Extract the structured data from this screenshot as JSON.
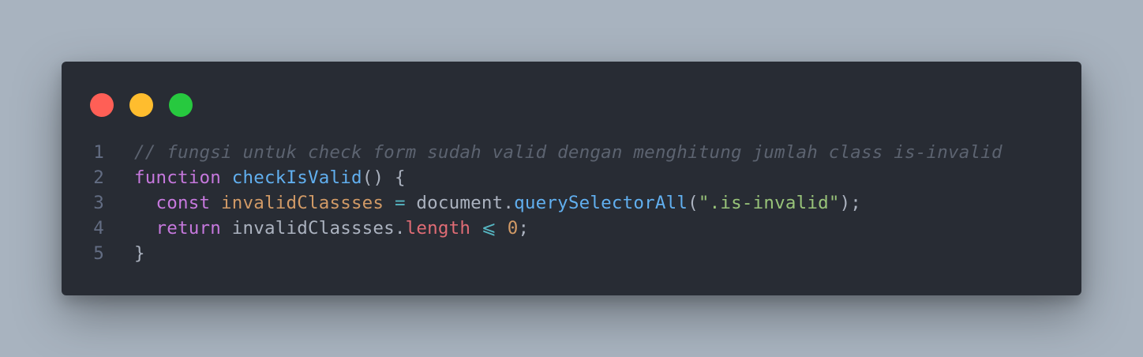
{
  "window": {
    "controls": [
      {
        "name": "close",
        "color": "#ff5f56"
      },
      {
        "name": "minimize",
        "color": "#ffbd2e"
      },
      {
        "name": "maximize",
        "color": "#27c93f"
      }
    ]
  },
  "code": {
    "lines": [
      {
        "number": "1",
        "tokens": [
          {
            "t": "// fungsi untuk check form sudah valid dengan menghitung jumlah class is-invalid",
            "k": "comment"
          }
        ]
      },
      {
        "number": "2",
        "tokens": [
          {
            "t": "function",
            "k": "kw"
          },
          {
            "t": " ",
            "k": "punc"
          },
          {
            "t": "checkIsValid",
            "k": "fn"
          },
          {
            "t": "() {",
            "k": "punc"
          }
        ]
      },
      {
        "number": "3",
        "tokens": [
          {
            "t": "  ",
            "k": "punc"
          },
          {
            "t": "const",
            "k": "kw"
          },
          {
            "t": " ",
            "k": "punc"
          },
          {
            "t": "invalidClassses",
            "k": "var"
          },
          {
            "t": " ",
            "k": "punc"
          },
          {
            "t": "=",
            "k": "op"
          },
          {
            "t": " document.",
            "k": "punc"
          },
          {
            "t": "querySelectorAll",
            "k": "fn"
          },
          {
            "t": "(",
            "k": "punc"
          },
          {
            "t": "\".is-invalid\"",
            "k": "str"
          },
          {
            "t": ");",
            "k": "punc"
          }
        ]
      },
      {
        "number": "4",
        "tokens": [
          {
            "t": "  ",
            "k": "punc"
          },
          {
            "t": "return",
            "k": "kw"
          },
          {
            "t": " invalidClassses.",
            "k": "punc"
          },
          {
            "t": "length",
            "k": "prop"
          },
          {
            "t": " ",
            "k": "punc"
          },
          {
            "t": "⩽",
            "k": "op"
          },
          {
            "t": " ",
            "k": "punc"
          },
          {
            "t": "0",
            "k": "num"
          },
          {
            "t": ";",
            "k": "punc"
          }
        ]
      },
      {
        "number": "5",
        "tokens": [
          {
            "t": "}",
            "k": "punc"
          }
        ]
      }
    ]
  }
}
